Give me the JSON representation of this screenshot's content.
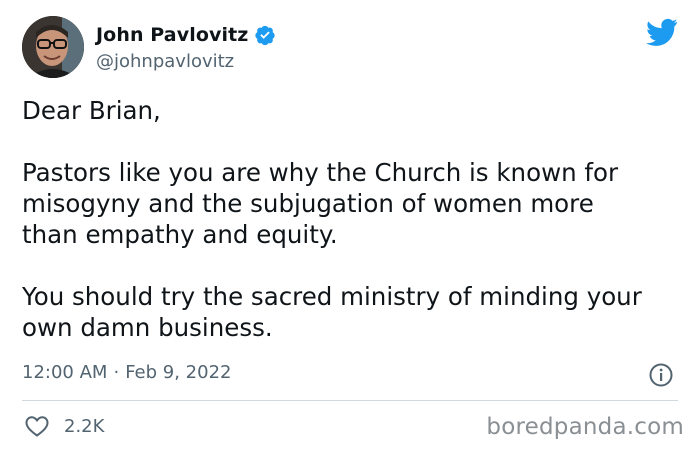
{
  "tweet": {
    "author": {
      "display_name": "John Pavlovitz",
      "handle": "@johnpavlovitz",
      "verified": true,
      "avatar_icon": "avatar-photo"
    },
    "brand_icon": "twitter-bird-icon",
    "brand_color": "#1d9bf0",
    "text_paragraphs": [
      [
        "Dear Brian,"
      ],
      [
        "Pastors like you are why the Church is known for",
        "misogyny and the subjugation of women more",
        "than empathy and equity."
      ],
      [
        "You should try the sacred ministry of minding your",
        "own damn business."
      ]
    ],
    "time": "12:00 AM",
    "separator": "·",
    "date": "Feb 9, 2022",
    "likes": "2.2K"
  },
  "watermark": "boredpanda.com"
}
